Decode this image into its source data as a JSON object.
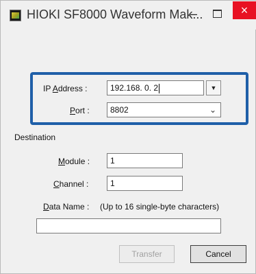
{
  "window": {
    "title": "HIOKI SF8000 Waveform Mak...",
    "min_glyph": "–",
    "close_glyph": "×",
    "close_color": "#e81123"
  },
  "connection": {
    "ip_label_prefix": "IP ",
    "ip_label_mnemonic": "A",
    "ip_label_rest": "ddress :",
    "ip_value": "192.168.  0.  2",
    "ip_dropdown_glyph": "▼",
    "port_label_mnemonic": "P",
    "port_label_rest": "ort :",
    "port_value": "8802",
    "port_chevron": "⌄",
    "highlight_color": "#1f5fa8"
  },
  "destination": {
    "heading": "Destination",
    "module_label_mnemonic": "M",
    "module_label_rest": "odule :",
    "module_value": "1",
    "channel_label_mnemonic": "C",
    "channel_label_rest": "hannel :",
    "channel_value": "1",
    "dataname_label_mnemonic": "D",
    "dataname_label_rest": "ata Name :",
    "dataname_hint": "(Up to 16 single-byte characters)",
    "dataname_value": ""
  },
  "buttons": {
    "transfer_label": "Transfer",
    "cancel_label": "Cancel"
  }
}
